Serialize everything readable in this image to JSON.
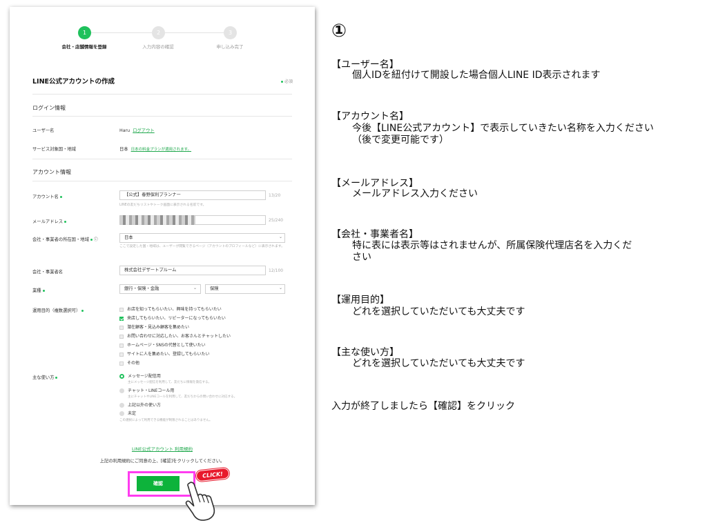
{
  "steps": [
    {
      "num": "1",
      "label": "会社・店舗情報を登録"
    },
    {
      "num": "2",
      "label": "入力内容の確認"
    },
    {
      "num": "3",
      "label": "申し込み完了"
    }
  ],
  "form": {
    "title": "LINE公式アカウントの作成",
    "required_note": "必須",
    "login_section": "ログイン情報",
    "username_label": "ユーザー名",
    "username_value": "Haru",
    "logout_link": "ログアウト",
    "service_label": "サービス対象国・地域",
    "service_value": "日本",
    "service_link": "日本の料金プランが適用されます。",
    "account_section": "アカウント情報",
    "account_name_label": "アカウント名",
    "account_name_value": "【公式】春野保利プランナー",
    "account_name_counter": "13/20",
    "account_name_help": "LINEの友だちリストやトーク画面に表示される名前です。",
    "email_label": "メールアドレス",
    "email_counter": "25/240",
    "country_label": "会社・事業者の所在国・地域",
    "country_value": "日本",
    "country_help": "ここで設定した国・地域は、ユーザーが閲覧できるページ（アカウントのプロフィールなど）に表示されます。",
    "company_label": "会社・事業者名",
    "company_value": "株式会社デザートプルーム",
    "company_counter": "12/100",
    "industry_label": "業種",
    "industry_value1": "銀行・保険・金融",
    "industry_value2": "保険",
    "purpose_label": "運用目的（複数選択可）",
    "purposes": [
      "お店を知ってもらいたい、興味を持ってもらいたい",
      "来店してもらいたい、リピーターになってもらいたい",
      "潜在顧客・見込み顧客を集めたい",
      "お問い合わせに対応したい、お客さんとチャットしたい",
      "ホームページ・SNSの代替として使いたい",
      "サイトに人を集めたい、登録してもらいたい",
      "その他"
    ],
    "usage_label": "主な使い方",
    "usages": [
      {
        "label": "メッセージ配信用",
        "desc": "主にメッセージ配信を利用して、友だちに情報を発信する。"
      },
      {
        "label": "チャット・LINEコール用",
        "desc": "主にチャットやLINEコールを利用して、友だちからの問い合わせに対応する。"
      },
      {
        "label": "上記以外の使い方",
        "desc": ""
      },
      {
        "label": "未定",
        "desc": ""
      }
    ],
    "usage_foot": "この選択によって利用できる機能が制限されることはありません。",
    "terms_link": "LINE公式アカウント 利用規約",
    "terms_note": "上記の利用規約にご同意の上、[確認]をクリックしてください。",
    "confirm_button": "確認",
    "click_badge": "CLICK!"
  },
  "explain": {
    "number": "①",
    "items": [
      {
        "head": "【ユーザー名】",
        "body": "個人IDを紐付けて開設した場合個人LINE ID表示されます"
      },
      {
        "head": "【アカウント名】",
        "body": "今後【LINE公式アカウント】で表示していきたい名称を入力ください（後で変更可能です）"
      },
      {
        "head": "【メールアドレス】",
        "body": "メールアドレス入力ください"
      },
      {
        "head": "【会社・事業者名】",
        "body": "特に表には表示等はされませんが、所属保険代理店名を入力ください"
      },
      {
        "head": "【運用目的】",
        "body": "どれを選択していただいても大丈夫です"
      },
      {
        "head": "【主な使い方】",
        "body": "どれを選択していただいても大丈夫です"
      }
    ],
    "final": "入力が終了しましたら【確認】をクリック"
  }
}
